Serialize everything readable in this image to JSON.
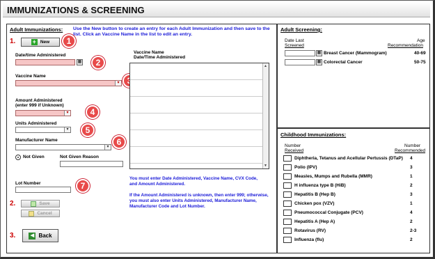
{
  "page": {
    "title": "IMMUNIZATIONS & SCREENING"
  },
  "adult_immunizations": {
    "heading": "Adult Immunizations:",
    "instructions": "Use the New button to create an entry for each Adult Immunization and then save to the list. Click an Vaccine Name in the list to edit an entry.",
    "new_button": "New",
    "date_label": "Date/time Administered",
    "vaccine_label": "Vaccine Name",
    "amount_label": "Amount Administered",
    "amount_sublabel": "(enter 999 if Unknown)",
    "units_label": "Units Administered",
    "manufacturer_label": "Manufacturer Name",
    "not_given_label": "Not Given",
    "not_given_reason_label": "Not Given Reason",
    "lot_label": "Lot Number",
    "save_button": "Save",
    "cancel_button": "Cancel",
    "back_button": "Back",
    "list_header_vaccine": "Vaccine Name",
    "list_header_date": "Date/Time Administered",
    "notice_1": "You must enter Date Administered, Vaccine Name, CVX Code, and Amount Administered.",
    "notice_2": "If the Amount Administered is unknown, then enter 999; otherwise, you must also enter Units Administered, Manufacturer Name, Manufacturer Code and Lot Number."
  },
  "steps": {
    "s1": "1.",
    "s2": "2.",
    "s3": "3.",
    "b1": "1",
    "b2": "2",
    "b3": "3",
    "b4": "4",
    "b5": "5",
    "b6": "6",
    "b7": "7"
  },
  "adult_screening": {
    "heading": "Adult Screening:",
    "col_date": "Date Last",
    "col_date2": "Screened",
    "col_age": "Age",
    "col_age2": "Recommendation",
    "rows": [
      {
        "name": "Breast Cancer (Mammogram)",
        "age": "40-69"
      },
      {
        "name": "Colorectal Cancer",
        "age": "50-75"
      }
    ]
  },
  "childhood": {
    "heading": "Childhood Immunizations:",
    "col_num": "Number",
    "col_num2": "Received",
    "col_rec": "Number",
    "col_rec2": "Recommended",
    "rows": [
      {
        "name": "Diphtheria, Tetanus and Acellular Pertussis (DTaP)",
        "rec": "4"
      },
      {
        "name": "Polio (IPV)",
        "rec": "3"
      },
      {
        "name": "Measles, Mumps and Rubella (MMR)",
        "rec": "1"
      },
      {
        "name": "H influenza type B (HiB)",
        "rec": "2"
      },
      {
        "name": "Hepatitis B (Hep B)",
        "rec": "3"
      },
      {
        "name": "Chicken pox (VZV)",
        "rec": "1"
      },
      {
        "name": "Pneumococcal Conjugate (PCV)",
        "rec": "4"
      },
      {
        "name": "Hepatitis A (Hep A)",
        "rec": "2"
      },
      {
        "name": "Rotavirus (RV)",
        "rec": "2-3"
      },
      {
        "name": "Influenza (flu)",
        "rec": "2"
      }
    ]
  },
  "colors": {
    "required_field": "#f6c6c6",
    "notice_text": "#1a1ad8",
    "badge": "#e84a4a",
    "step_label": "#cc0000"
  }
}
